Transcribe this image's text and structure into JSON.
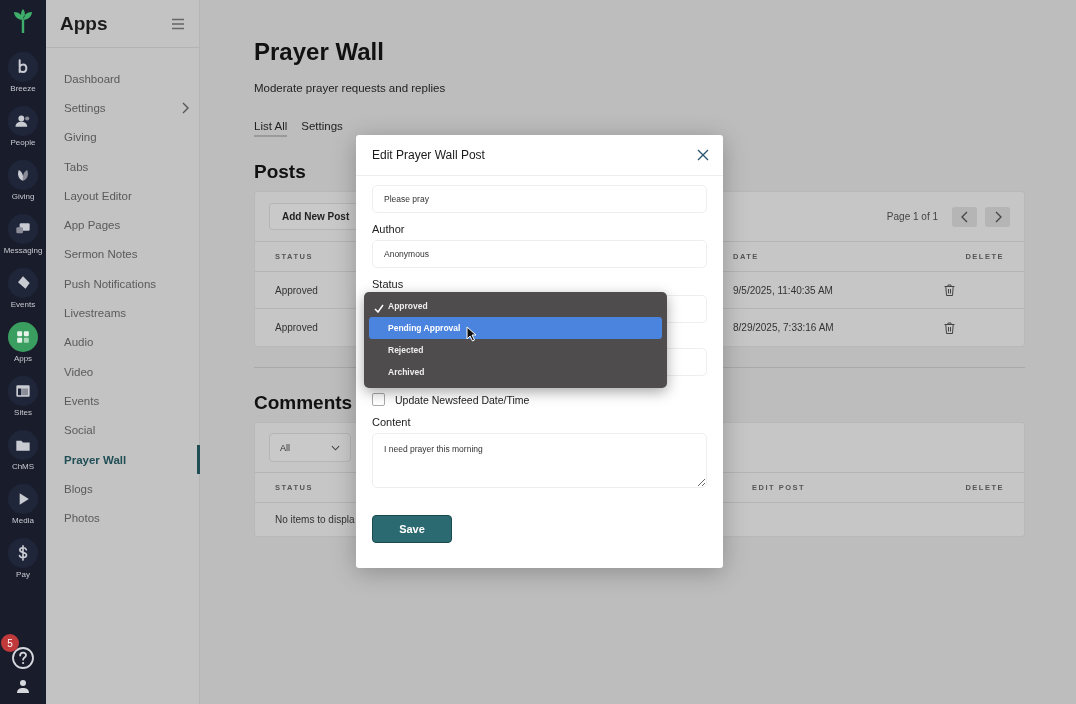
{
  "rail": {
    "items": [
      {
        "label": "Breeze",
        "selected": false
      },
      {
        "label": "People",
        "selected": false
      },
      {
        "label": "Giving",
        "selected": false
      },
      {
        "label": "Messaging",
        "selected": false
      },
      {
        "label": "Events",
        "selected": false
      },
      {
        "label": "Apps",
        "selected": true
      },
      {
        "label": "Sites",
        "selected": false
      },
      {
        "label": "ChMS",
        "selected": false
      },
      {
        "label": "Media",
        "selected": false
      },
      {
        "label": "Pay",
        "selected": false
      }
    ],
    "help_badge": "5"
  },
  "sidebar": {
    "title": "Apps",
    "items": [
      {
        "label": "Dashboard",
        "selected": false,
        "expandable": false
      },
      {
        "label": "Settings",
        "selected": false,
        "expandable": true
      },
      {
        "label": "Giving",
        "selected": false,
        "expandable": false
      },
      {
        "label": "Tabs",
        "selected": false,
        "expandable": false
      },
      {
        "label": "Layout Editor",
        "selected": false,
        "expandable": false
      },
      {
        "label": "App Pages",
        "selected": false,
        "expandable": false
      },
      {
        "label": "Sermon Notes",
        "selected": false,
        "expandable": false
      },
      {
        "label": "Push Notifications",
        "selected": false,
        "expandable": false
      },
      {
        "label": "Livestreams",
        "selected": false,
        "expandable": false
      },
      {
        "label": "Audio",
        "selected": false,
        "expandable": false
      },
      {
        "label": "Video",
        "selected": false,
        "expandable": false
      },
      {
        "label": "Events",
        "selected": false,
        "expandable": false
      },
      {
        "label": "Social",
        "selected": false,
        "expandable": false
      },
      {
        "label": "Prayer Wall",
        "selected": true,
        "expandable": false
      },
      {
        "label": "Blogs",
        "selected": false,
        "expandable": false
      },
      {
        "label": "Photos",
        "selected": false,
        "expandable": false
      }
    ]
  },
  "page": {
    "title": "Prayer Wall",
    "subtitle": "Moderate prayer requests and replies",
    "tabs": [
      {
        "label": "List All",
        "selected": true
      },
      {
        "label": "Settings",
        "selected": false
      }
    ]
  },
  "posts": {
    "title": "Posts",
    "add_button": "Add New Post",
    "pagination": "Page 1 of 1",
    "columns": [
      "STATUS",
      "DATE",
      "DELETE"
    ],
    "rows": [
      {
        "status": "Approved",
        "date": "9/5/2025, 11:40:35 AM"
      },
      {
        "status": "Approved",
        "date": "8/29/2025, 7:33:16 AM"
      }
    ]
  },
  "comments": {
    "title": "Comments",
    "filter": "All",
    "columns": [
      "STATUS",
      "EDIT POST",
      "DELETE"
    ],
    "empty_text": "No items to displa"
  },
  "modal": {
    "title": "Edit Prayer Wall Post",
    "fields": [
      {
        "kind": "input",
        "value": "Please pray"
      },
      {
        "kind": "input",
        "label": "Author",
        "value": "Anonymous"
      },
      {
        "kind": "select",
        "label": "Status"
      },
      {
        "kind": "input"
      },
      {
        "kind": "checkbox",
        "label": "Update Newsfeed Date/Time",
        "checked": false
      },
      {
        "kind": "textarea",
        "label": "Content",
        "value": "I need prayer this morning"
      }
    ],
    "save_button": "Save"
  },
  "dropdown": {
    "options": [
      {
        "label": "Approved",
        "selected": true,
        "highlighted": false
      },
      {
        "label": "Pending Approval",
        "selected": false,
        "highlighted": true
      },
      {
        "label": "Rejected",
        "selected": false,
        "highlighted": false
      },
      {
        "label": "Archived",
        "selected": false,
        "highlighted": false
      }
    ]
  }
}
